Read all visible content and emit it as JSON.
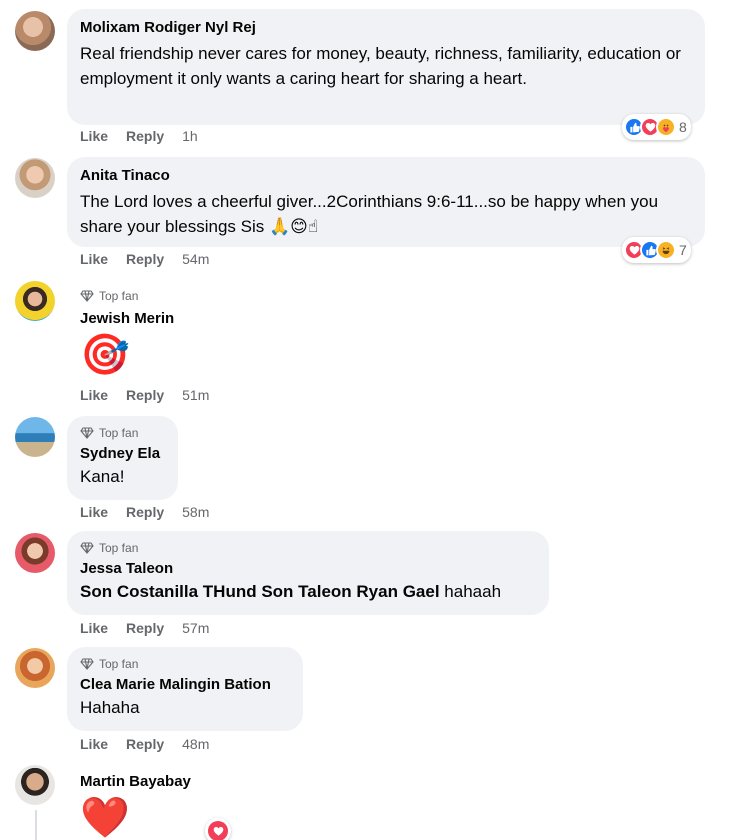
{
  "comments": [
    {
      "author": "Molixam Rodiger Nyl Rej",
      "text": "Real friendship never cares for money, beauty, richness, familiarity, education or employment it only wants a caring heart for sharing a heart.",
      "like": "Like",
      "reply": "Reply",
      "time": "1h",
      "reaction_count": "8",
      "reactions": [
        "like",
        "love",
        "care"
      ]
    },
    {
      "author": "Anita Tinaco",
      "text": "The Lord loves a cheerful giver...2Corinthians 9:6-11...so be happy when you share your blessings Sis 🙏😊☝",
      "like": "Like",
      "reply": "Reply",
      "time": "54m",
      "reaction_count": "7",
      "reactions": [
        "love",
        "like",
        "haha"
      ]
    },
    {
      "badge": "Top fan",
      "author": "Jewish Merin",
      "emoji": "🎯",
      "like": "Like",
      "reply": "Reply",
      "time": "51m"
    },
    {
      "badge": "Top fan",
      "author": "Sydney Ela",
      "text": "Kana!",
      "like": "Like",
      "reply": "Reply",
      "time": "58m"
    },
    {
      "badge": "Top fan",
      "author": "Jessa Taleon",
      "mentions": "Son Costanilla THund Son Taleon Ryan Gael",
      "text": "hahaah",
      "like": "Like",
      "reply": "Reply",
      "time": "57m"
    },
    {
      "badge": "Top fan",
      "author": "Clea Marie Malingin Bation",
      "text": "Hahaha",
      "like": "Like",
      "reply": "Reply",
      "time": "48m"
    },
    {
      "author": "Martin Bayabay",
      "emoji": "❤️"
    }
  ],
  "colors": {
    "bubble": "#f0f2f5",
    "meta": "#65676b",
    "like_blue": "#1877f2",
    "love_red": "#f33e58",
    "haha_yellow": "#f7b125"
  },
  "icons": {
    "badge": "diamond-icon",
    "like": "thumbs-up-icon",
    "love": "heart-icon",
    "care": "care-icon",
    "haha": "haha-icon"
  }
}
